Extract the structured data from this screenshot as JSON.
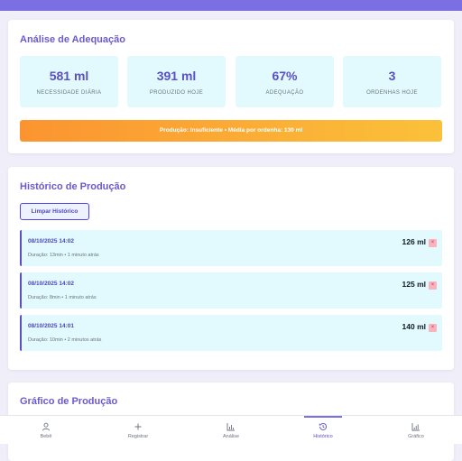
{
  "analysis": {
    "title": "Análise de Adequação",
    "stats": [
      {
        "value": "581 ml",
        "label": "NECESSIDADE DIÁRIA"
      },
      {
        "value": "391 ml",
        "label": "PRODUZIDO HOJE"
      },
      {
        "value": "67%",
        "label": "ADEQUAÇÃO"
      },
      {
        "value": "3",
        "label": "ORDENHAS HOJE"
      }
    ],
    "status": "Produção: Insuficiente • Média por ordenha: 130 ml",
    "status_colors": {
      "start": "#fb9430",
      "end": "#fbc13a"
    }
  },
  "history": {
    "title": "Histórico de Produção",
    "clear_label": "Limpar Histórico",
    "entries": [
      {
        "date": "08/10/2025 14:02",
        "meta": "Duração: 13min • 1 minuto atrás",
        "amount": "126 ml"
      },
      {
        "date": "08/10/2025 14:02",
        "meta": "Duração: 8min • 1 minuto atrás",
        "amount": "125 ml"
      },
      {
        "date": "08/10/2025 14:01",
        "meta": "Duração: 10min • 2 minutos atrás",
        "amount": "140 ml"
      }
    ]
  },
  "chart": {
    "title": "Gráfico de Produção"
  },
  "nav": {
    "items": [
      {
        "label": "Bebê",
        "icon": "user-icon"
      },
      {
        "label": "Registrar",
        "icon": "plus-icon"
      },
      {
        "label": "Análise",
        "icon": "bar-chart-icon"
      },
      {
        "label": "Histórico",
        "icon": "history-icon"
      },
      {
        "label": "Gráfico",
        "icon": "chart-icon"
      }
    ],
    "active": "Histórico"
  },
  "colors": {
    "accent": "#7c6fe3",
    "card_tint": "#e2fafd",
    "background": "#efeef9"
  }
}
